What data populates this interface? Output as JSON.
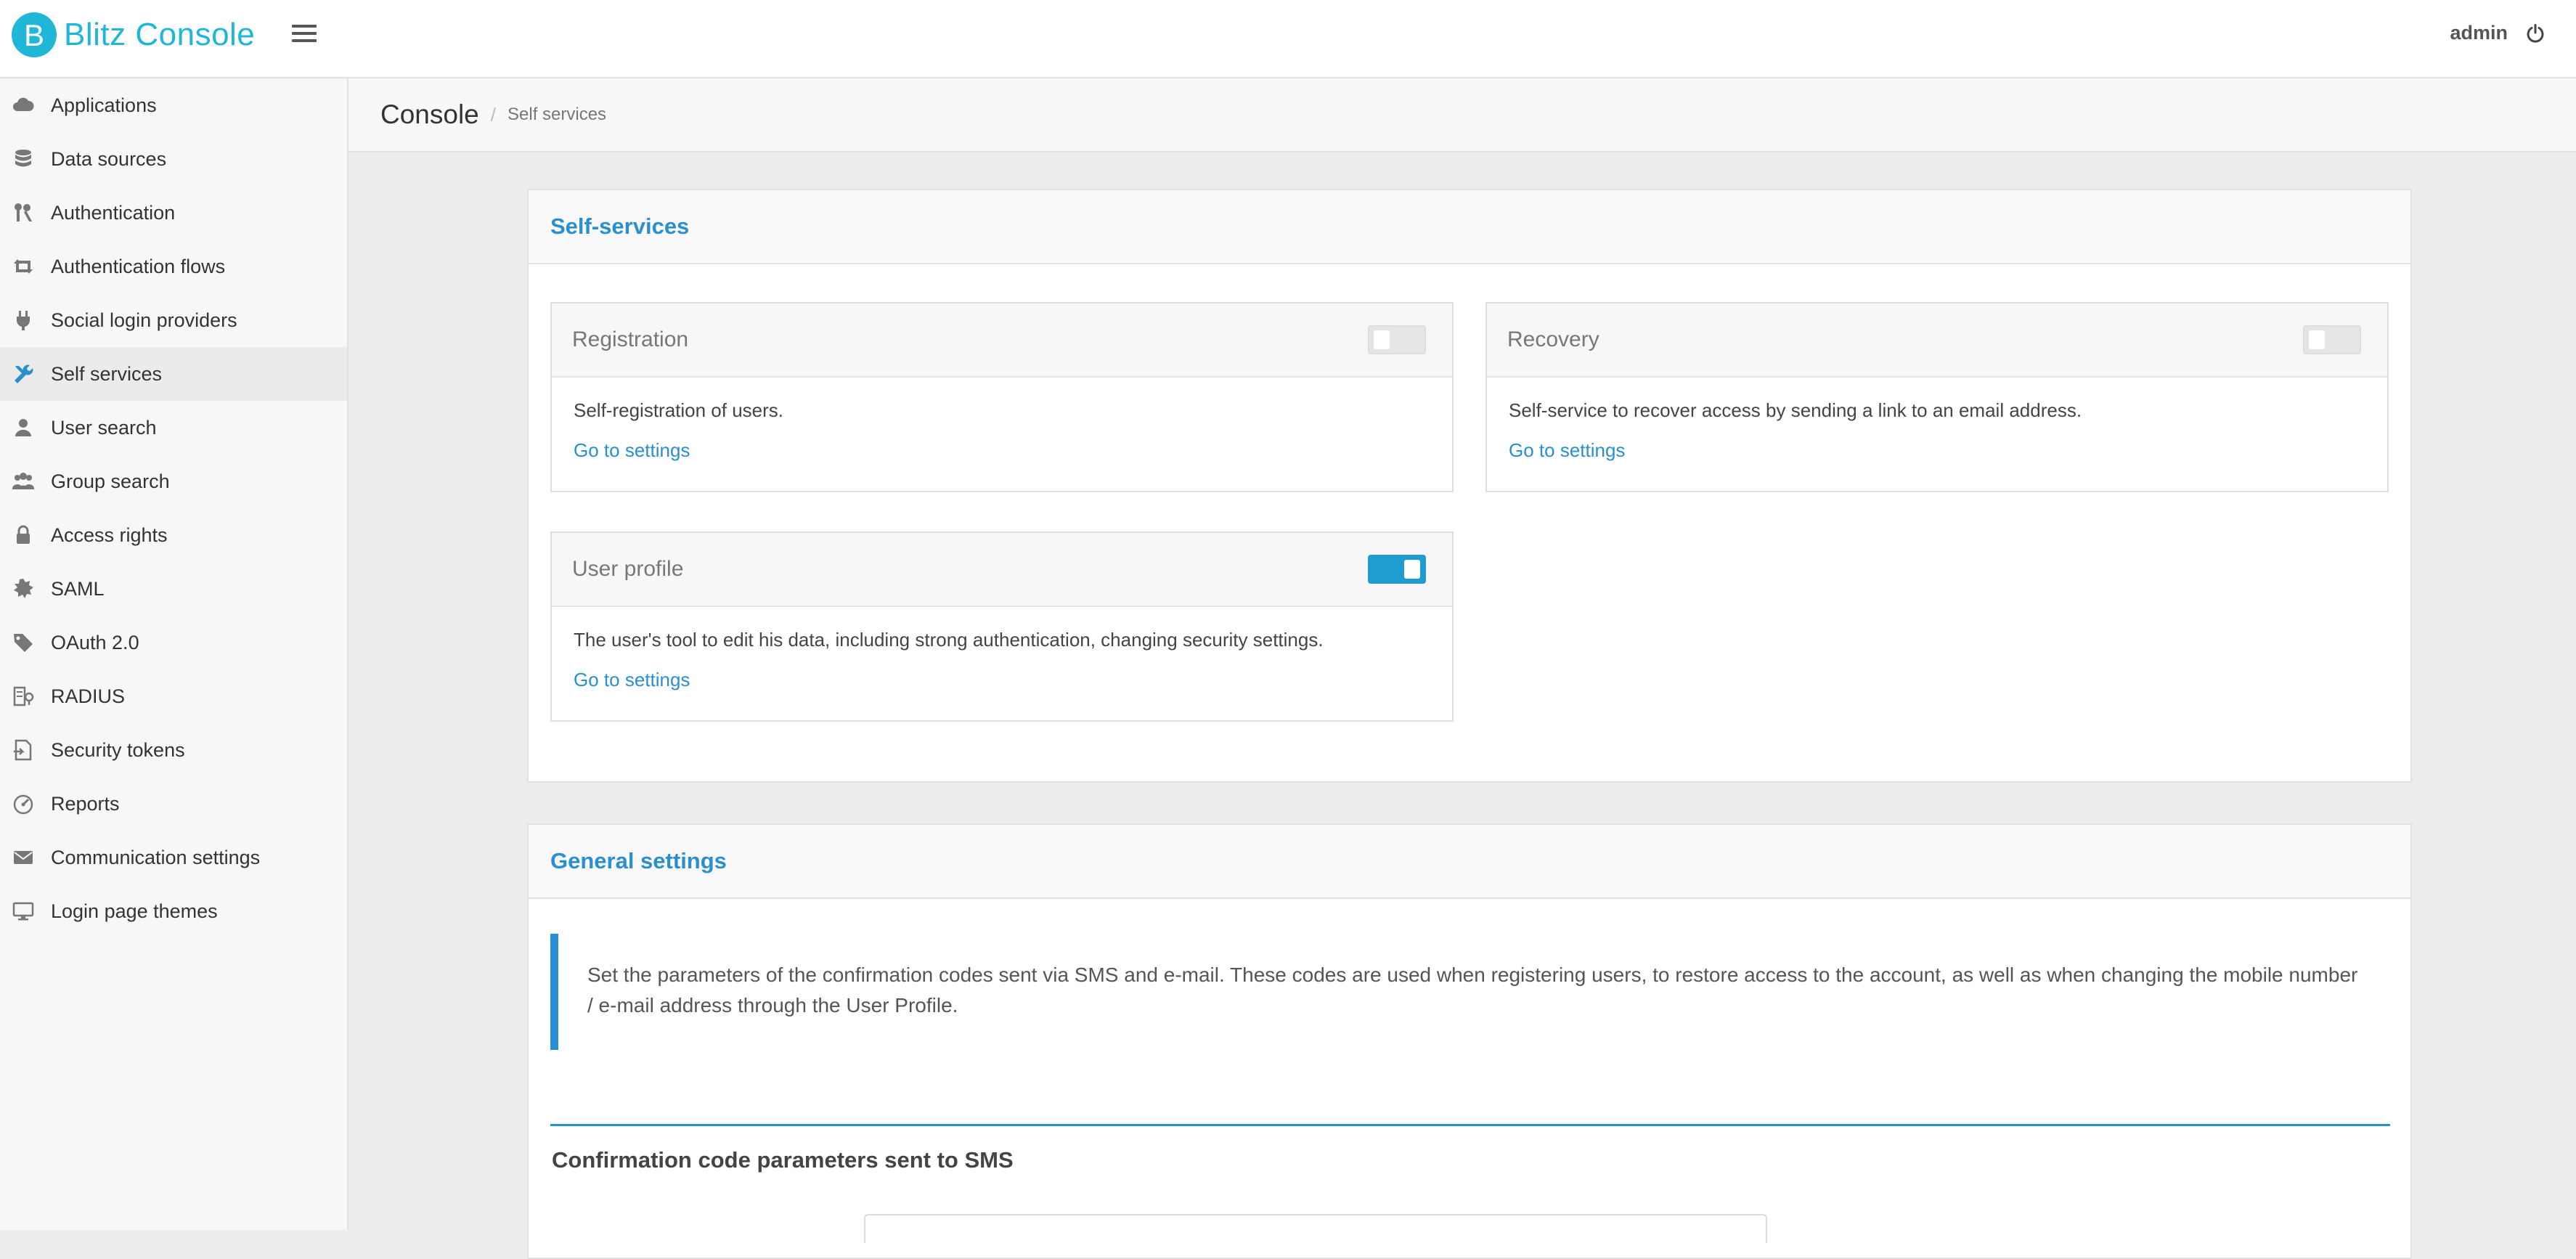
{
  "header": {
    "app_title": "Blitz Console",
    "logo_letter": "B",
    "user": "admin"
  },
  "sidebar": {
    "items": [
      {
        "label": "Applications",
        "icon": "cloud-icon"
      },
      {
        "label": "Data sources",
        "icon": "database-icon"
      },
      {
        "label": "Authentication",
        "icon": "keys-icon"
      },
      {
        "label": "Authentication flows",
        "icon": "retweet-icon"
      },
      {
        "label": "Social login providers",
        "icon": "plug-icon"
      },
      {
        "label": "Self services",
        "icon": "wrench-icon",
        "active": true
      },
      {
        "label": "User search",
        "icon": "user-icon"
      },
      {
        "label": "Group search",
        "icon": "users-icon"
      },
      {
        "label": "Access rights",
        "icon": "lock-icon"
      },
      {
        "label": "SAML",
        "icon": "certificate-icon"
      },
      {
        "label": "OAuth 2.0",
        "icon": "tag-icon"
      },
      {
        "label": "RADIUS",
        "icon": "server-icon"
      },
      {
        "label": "Security tokens",
        "icon": "token-file-icon"
      },
      {
        "label": "Reports",
        "icon": "dashboard-icon"
      },
      {
        "label": "Communication settings",
        "icon": "envelope-icon"
      },
      {
        "label": "Login page themes",
        "icon": "monitor-icon"
      }
    ]
  },
  "breadcrumb": {
    "root": "Console",
    "separator": "/",
    "current": "Self services"
  },
  "self_services": {
    "title": "Self-services",
    "cards": [
      {
        "title": "Registration",
        "enabled": false,
        "description": "Self-registration of users.",
        "link": "Go to settings"
      },
      {
        "title": "Recovery",
        "enabled": false,
        "description": "Self-service to recover access by sending a link to an email address.",
        "link": "Go to settings"
      },
      {
        "title": "User profile",
        "enabled": true,
        "description": "The user's tool to edit his data, including strong authentication, changing security settings.",
        "link": "Go to settings"
      }
    ]
  },
  "general_settings": {
    "title": "General settings",
    "note_line1": "Set the parameters of the confirmation codes sent via SMS and e-mail. These codes are used when registering users, to restore access to the account, as well as when changing the mobile number",
    "note_line2": "/ e-mail address through the User Profile.",
    "sms_heading": "Confirmation code parameters sent to SMS"
  },
  "colors": {
    "brand": "#1fb6d8",
    "accent": "#2a8fd0",
    "toggle_on": "#1f9dd1"
  }
}
